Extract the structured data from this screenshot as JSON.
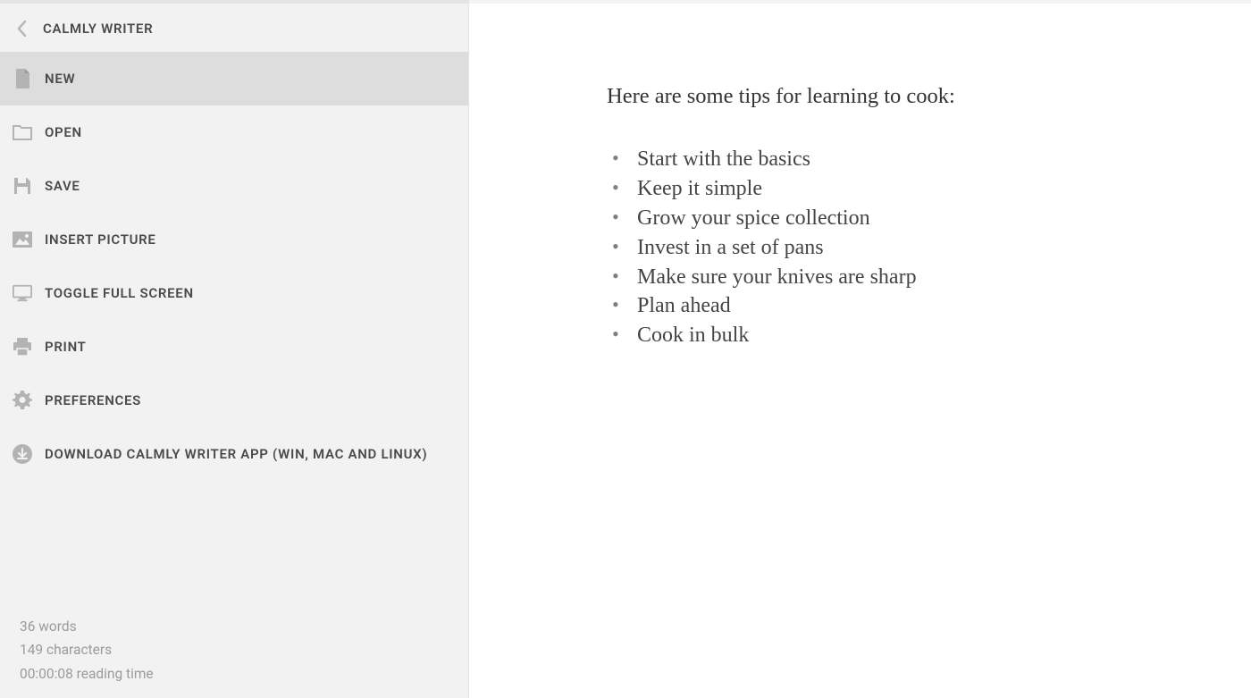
{
  "app": {
    "title": "CALMLY WRITER"
  },
  "menu": {
    "items": [
      {
        "label": "NEW",
        "icon": "file-icon",
        "selected": true
      },
      {
        "label": "OPEN",
        "icon": "folder-icon",
        "selected": false
      },
      {
        "label": "SAVE",
        "icon": "save-icon",
        "selected": false
      },
      {
        "label": "INSERT PICTURE",
        "icon": "image-icon",
        "selected": false
      },
      {
        "label": "TOGGLE FULL SCREEN",
        "icon": "monitor-icon",
        "selected": false
      },
      {
        "label": "PRINT",
        "icon": "printer-icon",
        "selected": false
      },
      {
        "label": "PREFERENCES",
        "icon": "gear-icon",
        "selected": false
      },
      {
        "label": "DOWNLOAD CALMLY WRITER APP (WIN, MAC AND LINUX)",
        "icon": "download-icon",
        "selected": false
      }
    ]
  },
  "stats": {
    "words": "36 words",
    "characters": "149 characters",
    "reading_time": "00:00:08 reading time"
  },
  "document": {
    "heading": "Here are some tips for learning to cook:",
    "list_items": [
      "Start with the basics",
      "Keep it simple",
      "Grow your spice collection",
      "Invest in a set of pans",
      "Make sure your knives are sharp",
      "Plan ahead",
      "Cook in bulk"
    ]
  }
}
